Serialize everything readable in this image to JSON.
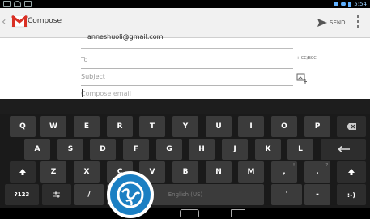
{
  "status": {
    "time": "5:54",
    "icons": [
      "screen-icon",
      "wifi-icon",
      "image-icon",
      "data-icon",
      "wifi-signal-icon",
      "battery-icon"
    ]
  },
  "actionbar": {
    "title": "Compose",
    "send_label": "SEND"
  },
  "compose": {
    "from_account": "anneshuoli@gmail.com",
    "to_placeholder": "To",
    "cc_bcc_label": "+ CC/BCC",
    "subject_placeholder": "Subject",
    "body_placeholder": "Compose email"
  },
  "keyboard": {
    "row1": [
      {
        "label": "Q",
        "hint": ""
      },
      {
        "label": "W",
        "hint": ""
      },
      {
        "label": "E",
        "hint": ""
      },
      {
        "label": "R",
        "hint": ""
      },
      {
        "label": "T",
        "hint": ""
      },
      {
        "label": "Y",
        "hint": ""
      },
      {
        "label": "U",
        "hint": ""
      },
      {
        "label": "I",
        "hint": ""
      },
      {
        "label": "O",
        "hint": ""
      },
      {
        "label": "P",
        "hint": ""
      }
    ],
    "row2": [
      {
        "label": "A"
      },
      {
        "label": "S"
      },
      {
        "label": "D"
      },
      {
        "label": "F"
      },
      {
        "label": "G"
      },
      {
        "label": "H"
      },
      {
        "label": "J"
      },
      {
        "label": "K"
      },
      {
        "label": "L"
      }
    ],
    "row3": [
      {
        "label": "Z"
      },
      {
        "label": "X"
      },
      {
        "label": "C"
      },
      {
        "label": "V"
      },
      {
        "label": "B"
      },
      {
        "label": "N"
      },
      {
        "label": "M"
      },
      {
        "label": ",",
        "hint": "!"
      },
      {
        "label": ".",
        "hint": "?"
      }
    ],
    "mode_label": "?123",
    "slash_label": "/",
    "space_label": "English (US)",
    "apostrophe_label": "'",
    "dash_label": "-",
    "smiley_label": ":-)"
  },
  "colors": {
    "keyboard_bg": "#1a1a1a",
    "key_bg": "#3b3b3b",
    "accent": "#1b7fc3"
  }
}
